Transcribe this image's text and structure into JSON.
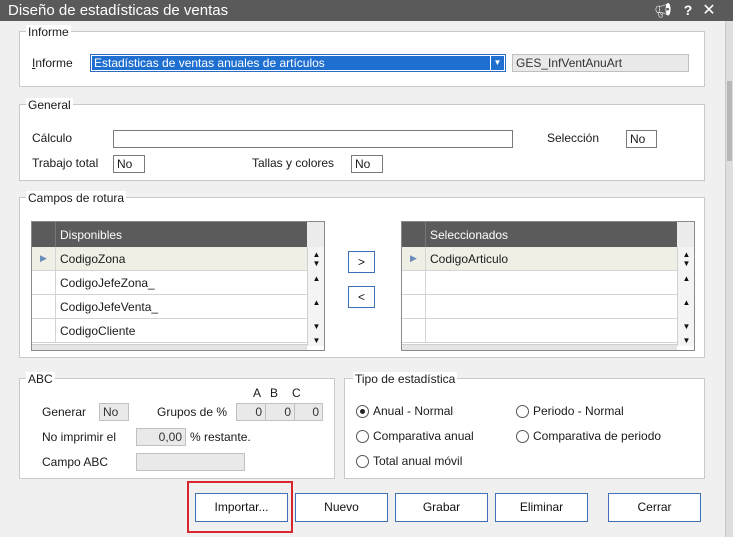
{
  "window": {
    "title": "Diseño de estadísticas de ventas",
    "icons": {
      "megaphone": "megaphone-icon",
      "help": "help-icon",
      "close": "close-icon"
    }
  },
  "informe": {
    "group_label": "Informe",
    "label": "Informe",
    "selected": "Estadísticas de ventas anuales de artículos",
    "code": "GES_InfVentAnuArt"
  },
  "general": {
    "group_label": "General",
    "calculo_label": "Cálculo",
    "calculo_value": "",
    "seleccion_label": "Selección",
    "seleccion_value": "No",
    "trabajo_total_label": "Trabajo total",
    "trabajo_total_value": "No",
    "tallas_colores_label": "Tallas y colores",
    "tallas_colores_value": "No"
  },
  "campos_rotura": {
    "group_label": "Campos de rotura",
    "disponibles": {
      "header": "Disponibles",
      "rows": [
        "CodigoZona",
        "CodigoJefeZona_",
        "CodigoJefeVenta_",
        "CodigoCliente"
      ]
    },
    "seleccionados": {
      "header": "Seleccionados",
      "rows": [
        "CodigoArticulo",
        "",
        "",
        ""
      ]
    },
    "add_label": ">",
    "remove_label": "<"
  },
  "abc": {
    "group_label": "ABC",
    "generar_label": "Generar",
    "generar_value": "No",
    "grupos_label": "Grupos de %",
    "col_a": "A",
    "col_b": "B",
    "col_c": "C",
    "val_a": "0",
    "val_b": "0",
    "val_c": "0",
    "no_imprimir_label": "No imprimir el",
    "no_imprimir_value": "0,00",
    "restante_label": "% restante.",
    "campo_abc_label": "Campo ABC",
    "campo_abc_value": ""
  },
  "tipo": {
    "group_label": "Tipo de estadística",
    "options": [
      "Anual - Normal",
      "Periodo - Normal",
      "Comparativa anual",
      "Comparativa de periodo",
      "Total anual móvil"
    ],
    "selected": "Anual - Normal"
  },
  "buttons": {
    "importar": "Importar...",
    "nuevo": "Nuevo",
    "grabar": "Grabar",
    "eliminar": "Eliminar",
    "cerrar": "Cerrar"
  },
  "colors": {
    "titlebar": "#5a5a5a",
    "selection": "#1e6fd0",
    "grid_header": "#5b5b5b",
    "highlight": "#d9262d"
  }
}
